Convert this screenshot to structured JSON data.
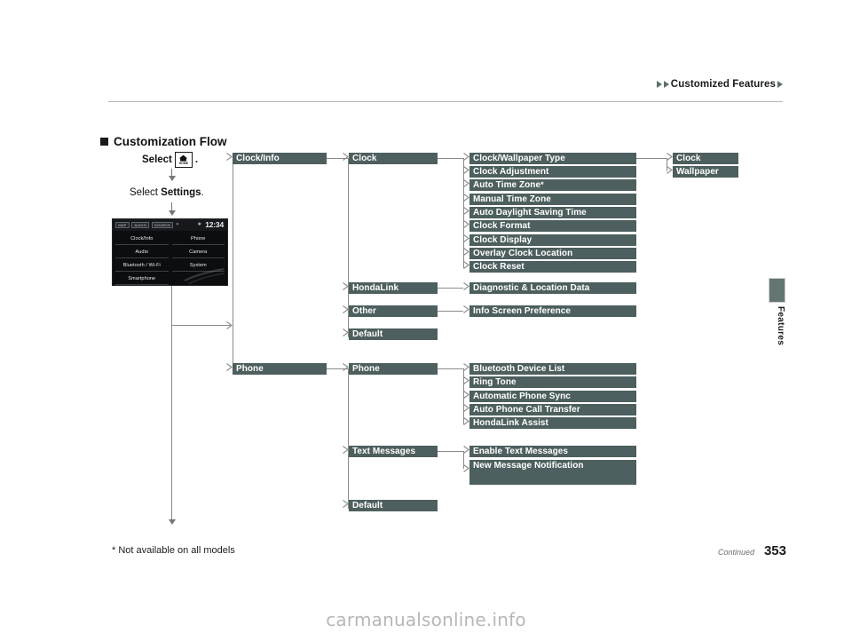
{
  "header": {
    "breadcrumb": "Customized Features"
  },
  "section": {
    "heading": "Customization Flow"
  },
  "left_column": {
    "step1_prefix": "Select",
    "step1_icon_label": "HOME",
    "step1_suffix": ".",
    "step2_prefix": "Select ",
    "step2_bold": "Settings",
    "step2_suffix": "."
  },
  "nav_screenshot": {
    "status_chips": [
      "MAP",
      "AUDIO",
      "SOURCE"
    ],
    "status_icons": [
      "✶",
      "✱"
    ],
    "time": "12:34",
    "menu_items": [
      "Clock/Info",
      "Phone",
      "Audio",
      "Camera",
      "Bluetooth / Wi-Fi",
      "System",
      "Smartphone",
      ""
    ]
  },
  "flow": {
    "level1": [
      {
        "label": "Clock/Info"
      },
      {
        "label": "Phone"
      }
    ],
    "level2_clockinfo": [
      {
        "label": "Clock"
      },
      {
        "label": "HondaLink"
      },
      {
        "label": "Other"
      },
      {
        "label": "Default"
      }
    ],
    "level2_phone": [
      {
        "label": "Phone"
      },
      {
        "label": "Text Messages"
      },
      {
        "label": "Default"
      }
    ],
    "level3_clock": [
      {
        "label": "Clock/Wallpaper Type",
        "star": false
      },
      {
        "label": "Clock Adjustment",
        "star": false
      },
      {
        "label": "Auto Time Zone",
        "star": true
      },
      {
        "label": "Manual Time Zone",
        "star": false
      },
      {
        "label": "Auto Daylight Saving Time",
        "star": false
      },
      {
        "label": "Clock Format",
        "star": false
      },
      {
        "label": "Clock Display",
        "star": false
      },
      {
        "label": "Overlay Clock Location",
        "star": false
      },
      {
        "label": "Clock Reset",
        "star": false
      }
    ],
    "level3_hondalink": [
      {
        "label": "Diagnostic & Location Data"
      }
    ],
    "level3_other": [
      {
        "label": "Info Screen Preference"
      }
    ],
    "level3_phone": [
      {
        "label": "Bluetooth Device List"
      },
      {
        "label": "Ring Tone"
      },
      {
        "label": "Automatic Phone Sync"
      },
      {
        "label": "Auto Phone Call Transfer"
      },
      {
        "label": "HondaLink Assist"
      }
    ],
    "level3_text_messages": [
      {
        "label": "Enable Text Messages"
      },
      {
        "label": "New Message Notification"
      }
    ],
    "level4_clock_wallpaper_type": [
      {
        "label": "Clock"
      },
      {
        "label": "Wallpaper"
      }
    ]
  },
  "side_tab": {
    "label": "Features"
  },
  "footer": {
    "footnote": "* Not available on all models",
    "continued": "Continued",
    "page_number": "353"
  },
  "watermark": {
    "text": "carmanualsonline.info"
  },
  "colors": {
    "box_fill": "#4d5f5e",
    "connector": "#8b8b8b",
    "side_tab": "#637674",
    "breadcrumb_arrow": "#5f6f6c"
  }
}
